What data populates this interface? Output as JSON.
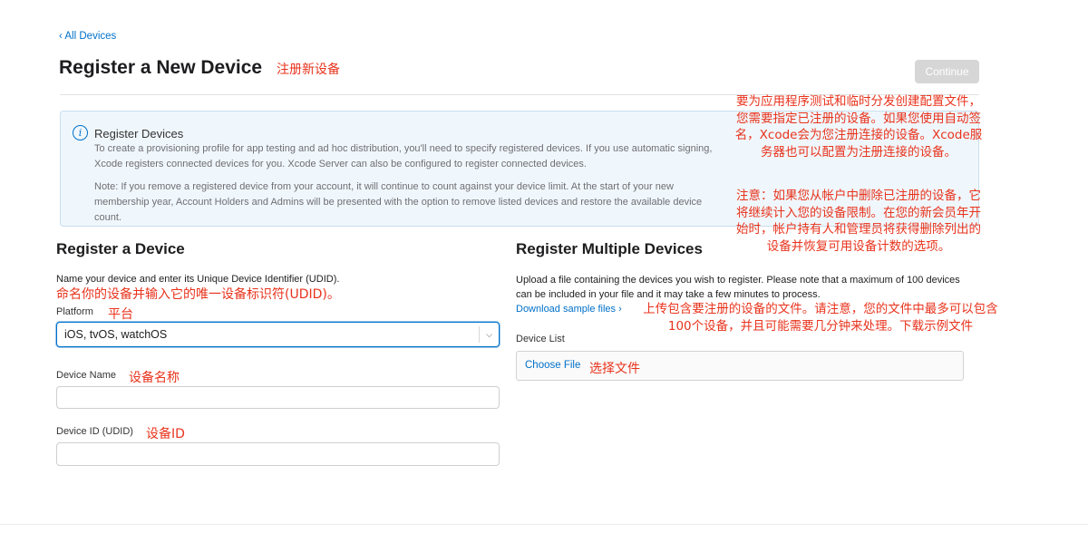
{
  "nav": {
    "back_label": "‹ All Devices"
  },
  "header": {
    "title": "Register a New Device",
    "title_annotation": "注册新设备",
    "continue_label": "Continue"
  },
  "info": {
    "icon": "info-icon",
    "title": "Register Devices",
    "para1": "To create a provisioning profile for app testing and ad hoc distribution, you'll need to specify registered devices. If you use automatic signing, Xcode registers connected devices for you. Xcode Server can also be configured to register connected devices.",
    "para2": "Note: If you remove a registered device from your account, it will continue to count against your device limit. At the start of your new membership year, Account Holders and Admins will be presented with the option to remove listed devices and restore the available device count.",
    "annotation1": "要为应用程序测试和临时分发创建配置文件，您需要指定已注册的设备。如果您使用自动签名，Xcode会为您注册连接的设备。Xcode服务器也可以配置为注册连接的设备。",
    "annotation2": "注意：如果您从帐户中删除已注册的设备，它将继续计入您的设备限制。在您的新会员年开始时，帐户持有人和管理员将获得删除列出的设备并恢复可用设备计数的选项。"
  },
  "single": {
    "title": "Register a Device",
    "description": "Name your device and enter its Unique Device Identifier (UDID).",
    "description_annotation": "命名你的设备并输入它的唯一设备标识符(UDID)。",
    "platform_label": "Platform",
    "platform_annotation": "平台",
    "platform_value": "iOS, tvOS, watchOS",
    "device_name_label": "Device Name",
    "device_name_annotation": "设备名称",
    "device_name_value": "",
    "device_id_label": "Device ID (UDID)",
    "device_id_annotation": "设备ID",
    "device_id_value": ""
  },
  "multiple": {
    "title": "Register Multiple Devices",
    "description": "Upload a file containing the devices you wish to register. Please note that a maximum of 100 devices can be included in your file and it may take a few minutes to process.",
    "sample_link": "Download sample files ›",
    "annotation": "上传包含要注册的设备的文件。请注意，您的文件中最多可以包含100个设备，并且可能需要几分钟来处理。下载示例文件",
    "device_list_label": "Device List",
    "choose_file_label": "Choose File",
    "choose_file_annotation": "选择文件"
  },
  "colors": {
    "link": "#0070c9",
    "annotation_red": "#e8331c",
    "info_bg": "#f0f7fc",
    "button_disabled": "#d6d6d6"
  }
}
